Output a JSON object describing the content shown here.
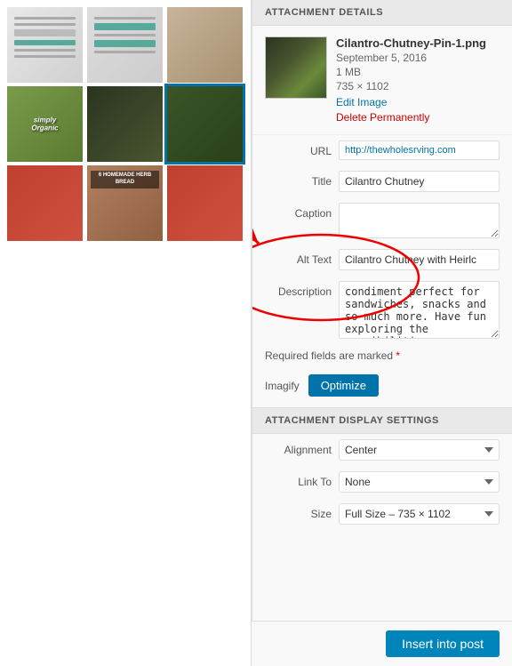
{
  "attachment_details_header": "ATTACHMENT DETAILS",
  "attachment": {
    "filename": "Cilantro-Chutney-Pin-1.png",
    "date": "September 5, 2016",
    "size": "1 MB",
    "dimensions": "735 × 1102",
    "edit_link": "Edit Image",
    "delete_link": "Delete Permanently"
  },
  "fields": {
    "url_label": "URL",
    "url_value": "http://thewholesrving.com",
    "title_label": "Title",
    "title_value": "Cilantro Chutney",
    "caption_label": "Caption",
    "caption_value": "",
    "alt_text_label": "Alt Text",
    "alt_text_value": "Cilantro Chutney with Heirlc",
    "description_label": "Description",
    "description_value": "condiment perfect for sandwiches, snacks and so much more. Have fun exploring the possibilities."
  },
  "required_note": "Required fields are marked",
  "imagify_label": "Imagify",
  "optimize_btn": "Optimize",
  "display_settings_header": "ATTACHMENT DISPLAY SETTINGS",
  "display": {
    "alignment_label": "Alignment",
    "alignment_value": "Center",
    "link_to_label": "Link To",
    "link_to_value": "None",
    "size_label": "Size",
    "size_value": "Full Size – 735 × 1102"
  },
  "insert_btn": "Insert into post",
  "thumbnails": [
    {
      "class": "thumb-1",
      "label": ""
    },
    {
      "class": "thumb-2",
      "label": ""
    },
    {
      "class": "thumb-3",
      "label": ""
    },
    {
      "class": "thumb-4",
      "label": "simply\nOrganic"
    },
    {
      "class": "thumb-5",
      "label": ""
    },
    {
      "class": "thumb-6",
      "label": "selected"
    },
    {
      "class": "thumb-7",
      "label": ""
    },
    {
      "class": "thumb-8",
      "label": "6 HOMEMADE\nHERB BREAD"
    },
    {
      "class": "thumb-9",
      "label": ""
    }
  ]
}
